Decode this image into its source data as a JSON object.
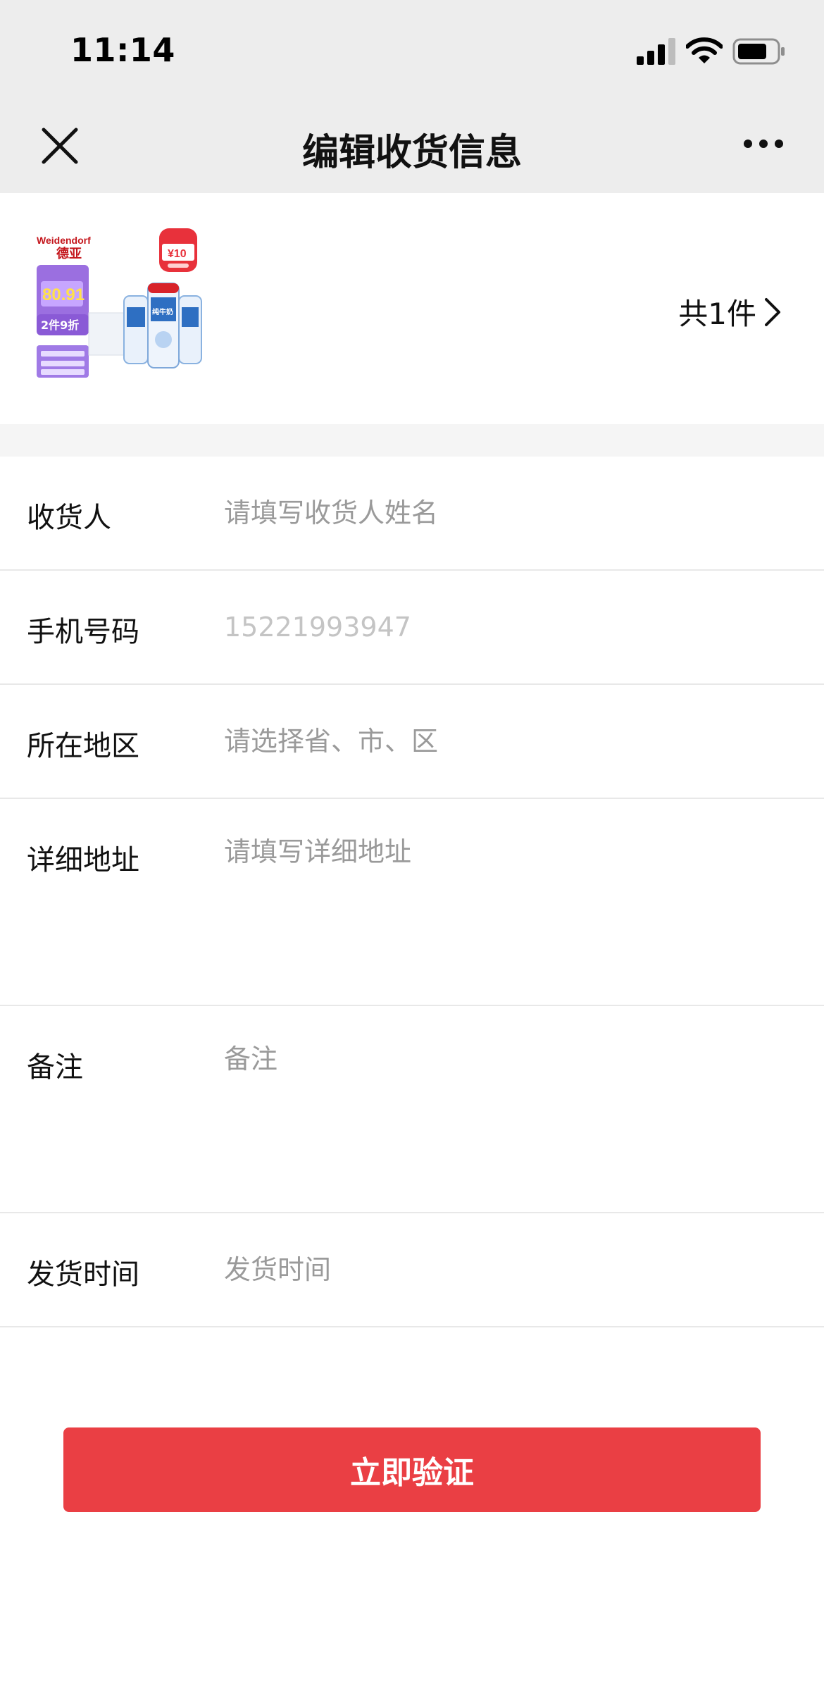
{
  "status_bar": {
    "time": "11:14",
    "icons": [
      "signal-icon",
      "wifi-icon",
      "battery-icon"
    ]
  },
  "nav": {
    "title": "编辑收货信息",
    "left_icon": "close-icon",
    "right_icon": "more-icon"
  },
  "product": {
    "image_texts": {
      "brand_en": "Weidendorf",
      "brand_cn": "德亚",
      "price": "80.91",
      "discount": "2件9折",
      "label": "纯牛奶",
      "coupon": "¥10"
    },
    "item_count": "共1件"
  },
  "form": {
    "receiver": {
      "label": "收货人",
      "placeholder": "请填写收货人姓名"
    },
    "phone": {
      "label": "手机号码",
      "placeholder": "15221993947"
    },
    "region": {
      "label": "所在地区",
      "placeholder": "请选择省、市、区"
    },
    "address": {
      "label": "详细地址",
      "placeholder": "请填写详细地址"
    },
    "remark": {
      "label": "备注",
      "placeholder": "备注"
    },
    "ship_time": {
      "label": "发货时间",
      "placeholder": "发货时间"
    }
  },
  "submit": {
    "label": "立即验证"
  },
  "colors": {
    "header_bg": "#ededed",
    "accent": "#ea3f44",
    "placeholder": "#9a9a9a",
    "divider": "#e8e8e8"
  }
}
